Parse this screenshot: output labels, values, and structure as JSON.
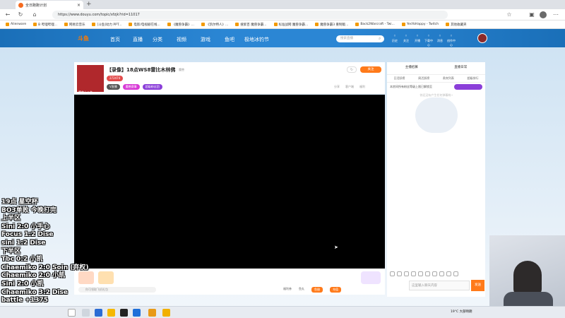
{
  "browser": {
    "tab_title": "全日跑跑计划",
    "url": "https://www.douyu.com/topic/xfzjk?rid=11017"
  },
  "bookmarks": [
    "Alienware",
    "B 哔哩哔哩...",
    "网易云音乐",
    "[斗鱼]动力 PPT...",
    "电影/电视剧在线...",
    "《魔兽争霸》...",
    "《凯尔特人》...",
    "搜索百 魔兽争霸...",
    "标准战网 魔兽争霸...",
    "魔兽争霸3 重制版...",
    "Back2Warcraft - Twi...",
    "YesYoHappy - Twitch",
    "其他收藏夹"
  ],
  "header": {
    "logo": "斗鱼",
    "nav": [
      "首页",
      "直播",
      "分类",
      "视频",
      "游戏",
      "鱼吧",
      "极地冰钓节"
    ],
    "search_placeholder": "搜索直播",
    "icons": [
      "历史",
      "关注",
      "开播",
      "下载中心",
      "消息",
      "创作中心"
    ]
  },
  "room": {
    "title": "【录像】18点WS8雷比木林佛",
    "anchor_name": "魔兽 | 公会",
    "category": "魔兽",
    "tags": [
      "V直播",
      "魔兽赛事",
      "超级粉丝团"
    ],
    "hot": "272474",
    "follow_label": "关注",
    "actions": [
      "分享",
      "客户端",
      "福利"
    ]
  },
  "toolbar": {
    "gift_hint": "你可领取飞机礼包",
    "items": [
      "福利券",
      "鱼丸",
      "鱼翅",
      "充值"
    ]
  },
  "sidebar": {
    "tabs": [
      "主播招募",
      "直播日常"
    ],
    "subtabs": [
      "日活跃榜",
      "周活跃榜",
      "贵宾列表",
      "超级排行"
    ],
    "notice": "本房间所有粉丝等级上限已解锁至",
    "empty_hint": "你还没有产生任何弹幕哟~",
    "chat_placeholder": "这里输入聊天内容",
    "send_label": "发送"
  },
  "overlay_lines": [
    "19点 星空杯",
    "BO3单败 今晚打完",
    "上半区",
    "Sini 2:0 小手心",
    "Focus 1:2 Dise",
    "sini 1:2 Dise",
    "下半区",
    "Tbc 0:2 小凯",
    "Chaemiko 2:0 Soin (弃权)",
    "Chaemiko 2:0 小凯",
    "Sini 2:0 小凯",
    "Chaemiko 3:2 Dise",
    "battle +1375"
  ],
  "taskbar": {
    "weather": "19°C 大部晴朗"
  },
  "colors": {
    "accent": "#ff7a1a",
    "header": "#2b86d4"
  }
}
